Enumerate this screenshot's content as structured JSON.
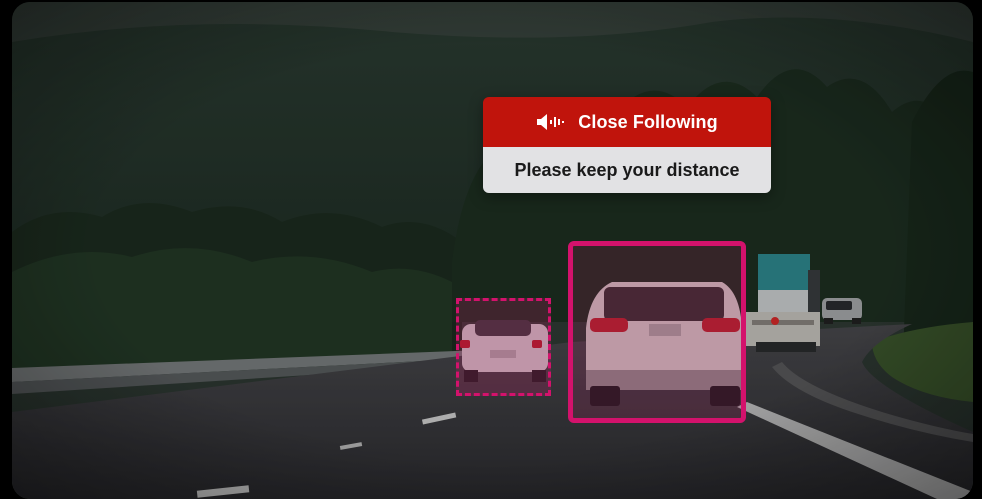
{
  "alert": {
    "title": "Close Following",
    "message": "Please keep your distance",
    "icon": "speaker-icon",
    "header_color": "#c0140c",
    "body_color": "#e2e2e4"
  },
  "detections": {
    "highlight_color": "#d3126c",
    "primary_target": "lead-vehicle",
    "secondary_target": "adjacent-vehicle"
  }
}
